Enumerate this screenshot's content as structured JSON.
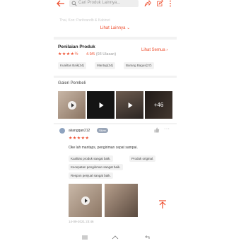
{
  "header": {
    "search_placeholder": "Cari Produk Lainnya..."
  },
  "description": {
    "faded_text": "Thai, Kon: Paribrandb & Kabinet",
    "more_label": "Lihat Lainnya"
  },
  "rating": {
    "title": "Penilaian Produk",
    "score": "4.9/5",
    "count": "(93 Ulasan)",
    "see_all_label": "Lihat Semua",
    "chips": [
      "Kualitas Baik(34)",
      "Mantap(34)",
      "Barang Bagus(27)"
    ]
  },
  "gallery": {
    "title": "Galeri Pembeli",
    "more_count": "+46"
  },
  "review": {
    "username": "akangqan212",
    "badge": "Silver",
    "comment": "Oke lah mantaps, pengiriman cepat sampai.",
    "tags": [
      "Kualitas produk sangat baik.",
      "Produk original.",
      "Kecepatan pengiriman sangat baik.",
      "Respon penjual sangat baik."
    ],
    "timestamp": "14-09-2021 23:46"
  },
  "colors": {
    "accent": "#ee4d2d",
    "star": "#ee4d2d"
  }
}
